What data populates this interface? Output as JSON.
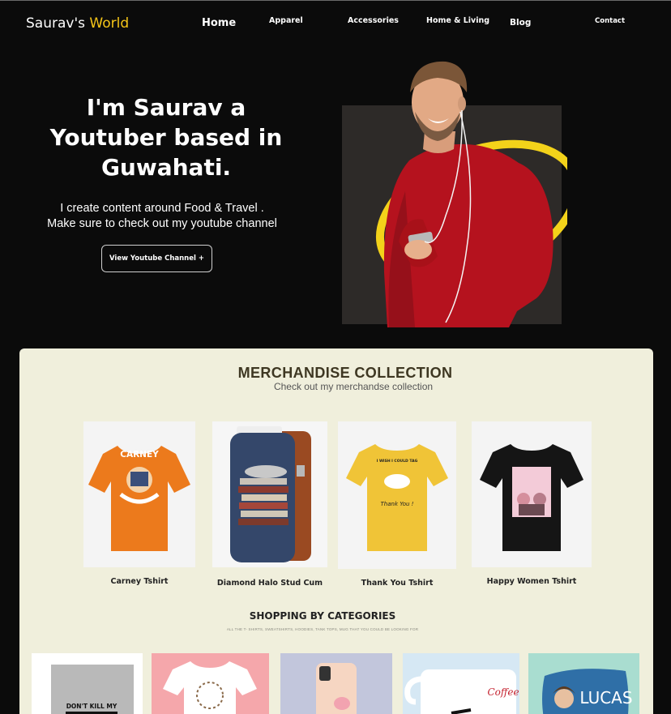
{
  "brand": {
    "name": "Saurav's",
    "accent": "World",
    "accent_color": "#f5c518"
  },
  "nav": {
    "home": "Home",
    "apparel": "Apparel",
    "accessories": "Accessories",
    "home_living": "Home & Living",
    "blog": "Blog",
    "contact": "Contact"
  },
  "hero": {
    "title": "I'm Saurav  a\nYoutuber based in\nGuwahati.",
    "subtitle": "I create content around Food & Travel .\nMake sure to check out my youtube channel",
    "cta": "View Youtube Channel +"
  },
  "merch": {
    "title": "MERCHANDISE COLLECTION",
    "subtitle": "Check out my merchandse collection",
    "products": [
      {
        "name": "Carney Tshirt",
        "icon": "orange-tshirt"
      },
      {
        "name": "Diamond Halo Stud Cum",
        "icon": "book-sleeve"
      },
      {
        "name": "Thank You Tshirt",
        "icon": "yellow-tshirt"
      },
      {
        "name": "Happy Women Tshirt",
        "icon": "black-tshirt"
      }
    ],
    "print_texts": {
      "carney": "CARNEY",
      "thank_top": "I WISH I COULD TAG",
      "thank_bottom": "Thank You !"
    }
  },
  "categories": {
    "title": "SHOPPING BY CATEGORIES",
    "subtitle": "ALL THE T- SHIRTS, SWEATSHIRTS, HOODIES, TANK TOPS, MUG THAT YOU COULD BE LOOKING FOR",
    "tiles": [
      {
        "icon": "grey-tshirt",
        "caption": "DON'T KILL MY"
      },
      {
        "icon": "white-tshirt"
      },
      {
        "icon": "phone-case"
      },
      {
        "icon": "mug",
        "caption": "Coffee"
      },
      {
        "icon": "pillow",
        "caption": "LUCAS"
      }
    ]
  }
}
